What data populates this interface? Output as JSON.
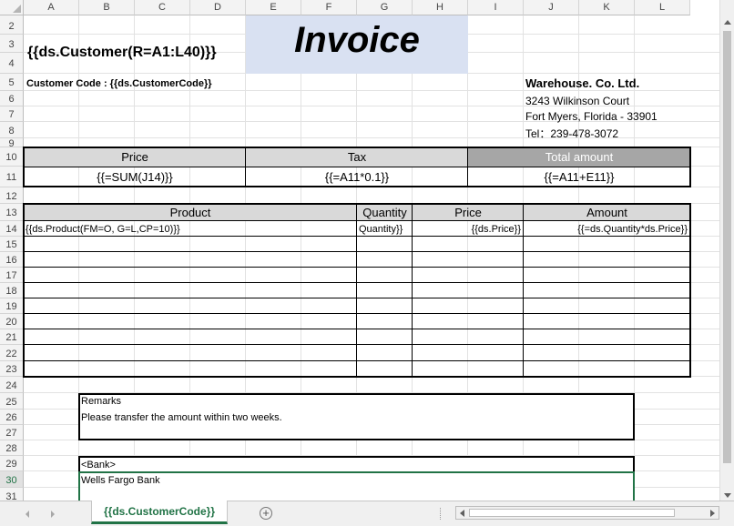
{
  "sheet": {
    "columns": [
      "A",
      "B",
      "C",
      "D",
      "E",
      "F",
      "G",
      "H",
      "I",
      "J",
      "K",
      "L"
    ],
    "rows": [
      "2",
      "3",
      "4",
      "5",
      "6",
      "7",
      "8",
      "9",
      "10",
      "11",
      "12",
      "13",
      "14",
      "15",
      "16",
      "17",
      "18",
      "19",
      "20",
      "21",
      "22",
      "23",
      "24",
      "25",
      "26",
      "27",
      "28",
      "29",
      "30",
      "31"
    ],
    "selected_row": "30"
  },
  "header": {
    "customer_formula": "{{ds.Customer(R=A1:L40)}}",
    "title": "Invoice",
    "customer_code": "Customer Code : {{ds.CustomerCode}}",
    "company": {
      "name": "Warehouse. Co. Ltd.",
      "address1": "3243 Wilkinson Court",
      "address2": "Fort Myers, Florida - 33901",
      "tel": "Tel：239-478-3072"
    }
  },
  "summary": {
    "price_label": "Price",
    "tax_label": "Tax",
    "total_label": "Total amount",
    "price_formula": "{{=SUM(J14)}}",
    "tax_formula": "{{=A11*0.1}}",
    "total_formula": "{{=A11+E11}}"
  },
  "detail": {
    "headers": {
      "product": "Product",
      "quantity": "Quantity",
      "price": "Price",
      "amount": "Amount"
    },
    "row": {
      "product": "{{ds.Product(FM=O, G=L,CP=10)}}",
      "quantity": "Quantity}}",
      "price": "{{ds.Price}}",
      "amount": "{{=ds.Quantity*ds.Price}}"
    }
  },
  "remarks": {
    "label": "Remarks",
    "text": "Please transfer the amount within two weeks."
  },
  "bank": {
    "label": "<Bank>",
    "name": "Wells Fargo Bank"
  },
  "tabs": {
    "active": "{{ds.CustomerCode}}"
  },
  "colors": {
    "accent": "#217346",
    "title_fill": "#d9e1f2",
    "header_fill": "#d9d9d9",
    "total_fill": "#a6a6a6"
  }
}
